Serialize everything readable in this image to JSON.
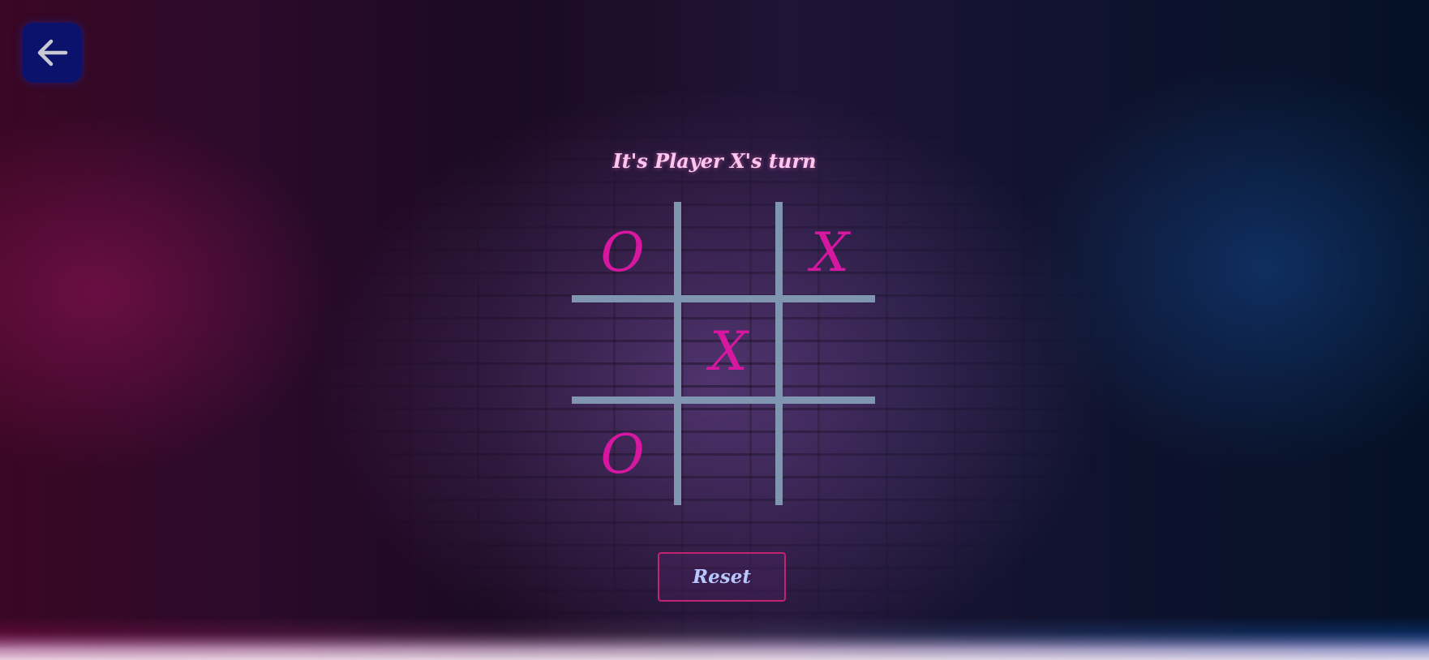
{
  "header": {
    "back_icon": "arrow-left-icon"
  },
  "game": {
    "status": "It's Player X's turn",
    "board": [
      "O",
      "",
      "X",
      "",
      "X",
      "",
      "O",
      "",
      ""
    ],
    "mark_color": "#d6179f",
    "grid_color": "#7f95b0"
  },
  "controls": {
    "reset_label": "Reset"
  },
  "colors": {
    "status_text": "#ffc7ef",
    "back_button_bg": "#0a126b",
    "reset_border": "#c2246f",
    "reset_text": "#b7c8ff"
  }
}
